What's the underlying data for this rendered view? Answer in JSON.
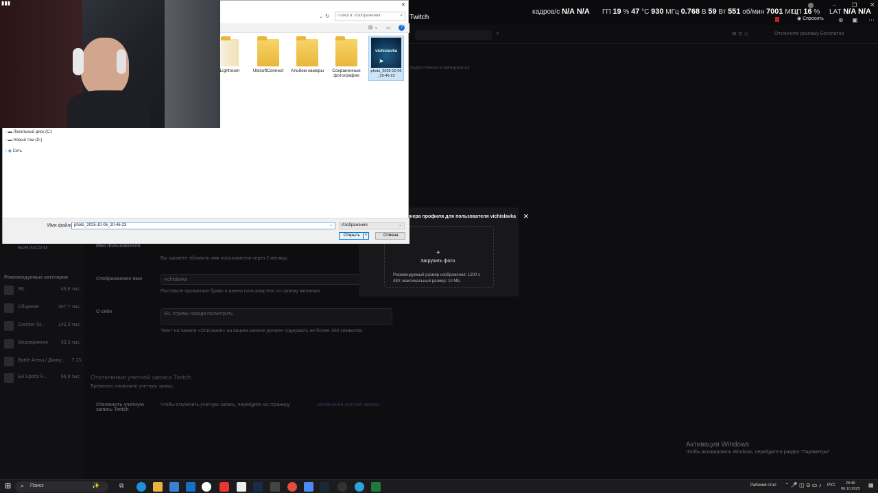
{
  "overlay": {
    "fps_label": "кадров/с",
    "fps_value": "N/A",
    "fps_value2": "N/A",
    "gpu_label": "ГП",
    "gpu_load": "19",
    "gpu_temp": "47",
    "gpu_clock": "930",
    "gpu_voltage": "0.768",
    "gpu_power": "59",
    "gpu_fan": "551",
    "gpu_mem_clock": "7001",
    "cpu_label": "ЦП",
    "cpu_load": "16",
    "lat_label": "LAT",
    "lat_value": "N/A",
    "lat_value2": "N/A",
    "units": {
      "pct": "%",
      "temp": "°C",
      "mhz": "МГц",
      "volt": "В",
      "watt": "Вт",
      "rpm": "об/мин"
    },
    "ask_label": "Спросить"
  },
  "browser": {
    "tab_title": "Twitch"
  },
  "twitch": {
    "promo": "Отключите рекламу Бесплатно",
    "notice": "редпочтения в материалах",
    "recommended_title": "Рекомендуемые категории",
    "channel_fragment": "ВАЕЧМСАГМ",
    "categories": [
      {
        "name": "IRL",
        "count": "46,8 тыс."
      },
      {
        "name": "Общение",
        "count": "307,7 тыс."
      },
      {
        "name": "Counter-St...",
        "count": "142,3 тыс."
      },
      {
        "name": "Мероприятия",
        "count": "33,3 тыс."
      },
      {
        "name": "Battle Arena / Джику...",
        "count": "7,13"
      },
      {
        "name": "EA Sports F...",
        "count": "56,9 тыс."
      }
    ],
    "username_label": "Имя пользователя",
    "username_hint": "Вы сможете обновить имя пользователя через 2 месяца.",
    "display_name_label": "Отображаемое имя",
    "display_name_value": "vichislavka",
    "display_name_hint": "Поставьте прописные буквы в имени пользователя по своему желанию.",
    "bio_label": "О себе",
    "bio_value": "IRL стримы заходи посмотрить",
    "bio_hint": "Текст на панели «Описание» на вашем канале должен содержать не более 300 символов.",
    "disable_title": "Отключение учетной записи Twitch",
    "disable_sub": "Временно отключите учетную запись",
    "disable_label": "Отключить учетную запись Twitch",
    "disable_text": "Чтобы отключить учетную запись, перейдите на страницу",
    "disable_link": "отключения учетной записи."
  },
  "modal": {
    "title": "ннера профиля для пользователя vichislavka",
    "upload_label": "Загрузить фото",
    "hint": "Рекомендуемый размер изображения: 1200 x 480; максимальный размер: 10 МБ.",
    "plus": "+",
    "close": "×"
  },
  "dialog": {
    "search_placeholder": "Поиск в: Изображения",
    "close": "×",
    "folders": [
      "Lightroom",
      "UbisoftConnect",
      "Альбом камеры",
      "Сохраненные фотографии"
    ],
    "selected_file": "photo_2025-10-06_20-46-23",
    "selected_thumb_text": "vichislavka",
    "tree": [
      "Локальный диск (C:)",
      "Новый том (D:)",
      "Сеть"
    ],
    "filename_label": "Имя файла:",
    "filename_value": "photo_2025-10-06_20-46-23",
    "filetype": "Изображения",
    "open": "Открыть",
    "cancel": "Отмена"
  },
  "activation": {
    "title": "Активация Windows",
    "text": "Чтобы активировать Windows, перейдите в раздел \"Параметры\"."
  },
  "taskbar": {
    "search": "Поиск",
    "desktop": "Рабочий стол",
    "lang": "РУС",
    "time": "20:46",
    "date": "06.10.2025"
  }
}
